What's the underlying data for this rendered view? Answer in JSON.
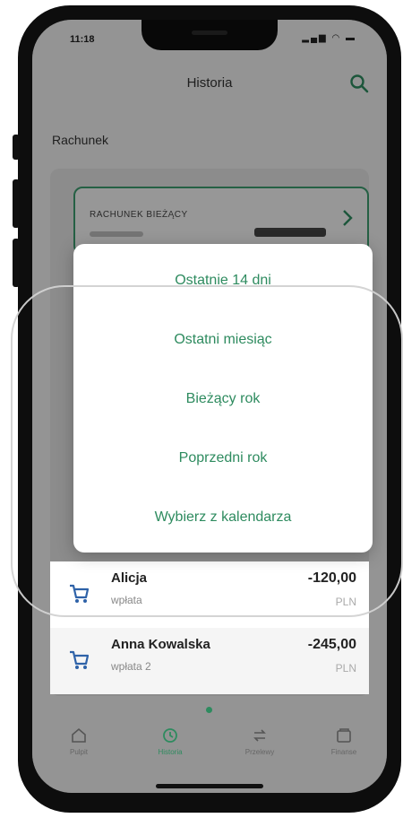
{
  "status_bar": {
    "time": "11:18",
    "icons": "▂▄▆ ◠ ▬"
  },
  "header": {
    "title": "Historia"
  },
  "section": {
    "label": "Rachunek"
  },
  "account": {
    "name": "RACHUNEK BIEŻĄCY"
  },
  "menu": {
    "items": [
      "Ostatnie 14 dni",
      "Ostatni miesiąc",
      "Bieżący rok",
      "Poprzedni rok",
      "Wybierz z kalendarza"
    ]
  },
  "transactions": [
    {
      "name": "Alicja",
      "type": "wpłata",
      "amount": "-120,00",
      "currency": "PLN",
      "icon": "cart-icon"
    },
    {
      "name": "Anna Kowalska",
      "type": "wpłata 2",
      "amount": "-245,00",
      "currency": "PLN",
      "icon": "cart-icon"
    }
  ],
  "nav": {
    "items": [
      {
        "label": "Pulpit",
        "icon": "home-icon"
      },
      {
        "label": "Historia",
        "icon": "history-icon",
        "active": true
      },
      {
        "label": "Przelewy",
        "icon": "transfer-icon"
      },
      {
        "label": "Finanse",
        "icon": "wallet-icon"
      }
    ]
  },
  "colors": {
    "accent": "#2e8b5f",
    "dim_overlay": "rgba(0,0,0,0.38)"
  }
}
